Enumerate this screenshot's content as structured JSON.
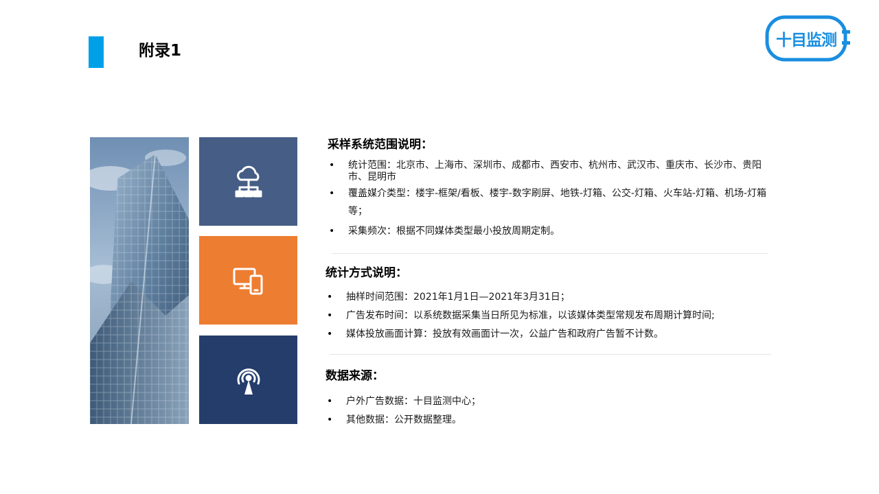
{
  "header": {
    "title": "附录1",
    "logo_text": "十目监测"
  },
  "colors": {
    "accent": "#00a0e9",
    "tile_1": "#465d85",
    "tile_2": "#ed7d31",
    "tile_3": "#253d6b",
    "logo": "#1a8ee0"
  },
  "icons": {
    "tile_1": "cloud-network-icon",
    "tile_2": "devices-icon",
    "tile_3": "broadcast-tower-icon"
  },
  "sections": {
    "sampling": {
      "title": "采样系统范围说明：",
      "items": [
        "统计范围：北京市、上海市、深圳市、成都市、西安市、杭州市、武汉市、重庆市、长沙市、贵阳市、昆明市",
        "覆盖媒介类型：楼宇-框架/看板、楼宇-数字刷屏、地铁-灯箱、公交-灯箱、火车站-灯箱、机场-灯箱等；",
        "采集频次：根据不同媒体类型最小投放周期定制。"
      ]
    },
    "statistics": {
      "title": "统计方式说明：",
      "items": [
        "抽样时间范围：2021年1月1日—2021年3月31日；",
        "广告发布时间：以系统数据采集当日所见为标准，以该媒体类型常规发布周期计算时间;",
        "媒体投放画面计算：投放有效画面计一次，公益广告和政府广告暂不计数。"
      ]
    },
    "source": {
      "title": "数据来源：",
      "items": [
        "户外广告数据：十目监测中心；",
        "其他数据：公开数据整理。"
      ]
    }
  }
}
